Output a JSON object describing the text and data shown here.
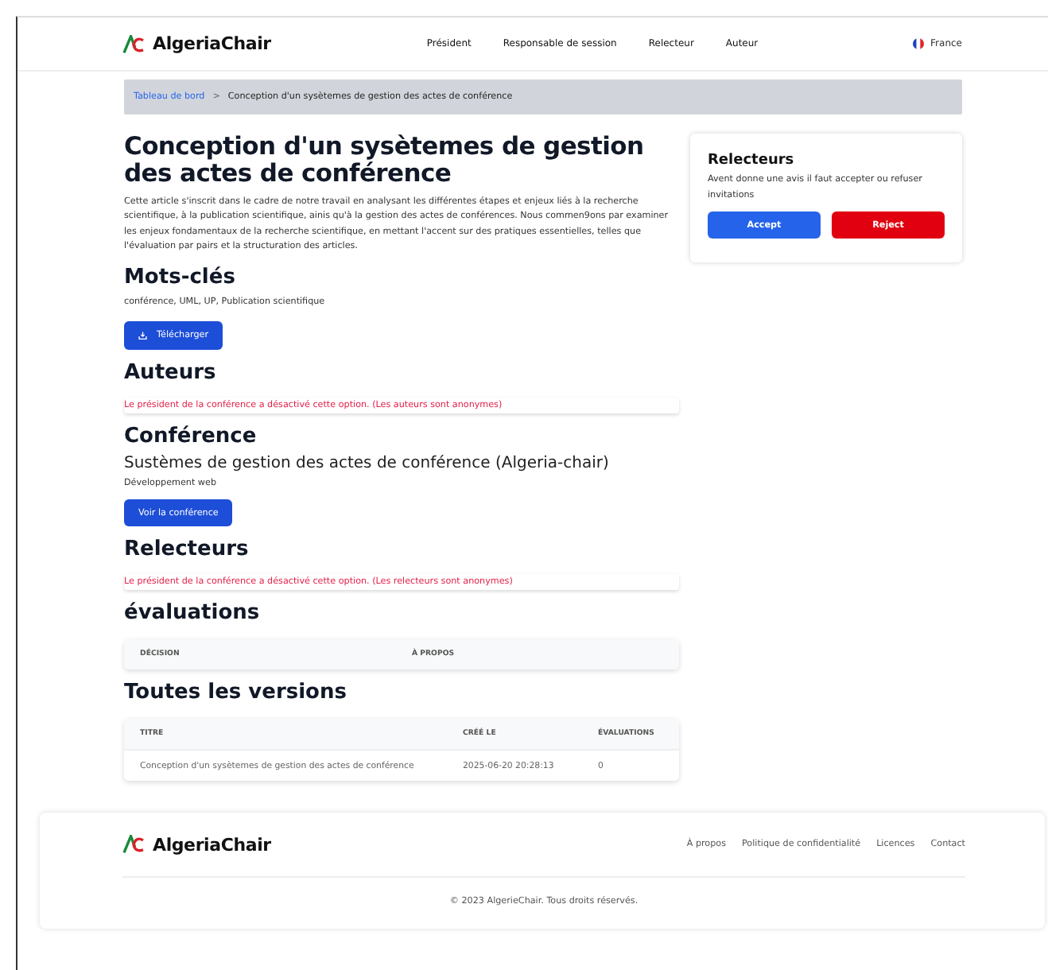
{
  "brand": "AlgeriaChair",
  "nav": [
    "Président",
    "Responsable de session",
    "Relecteur",
    "Auteur"
  ],
  "language": "France",
  "breadcrumb": {
    "link": "Tableau de bord",
    "separator": ">",
    "current": "Conception d'un sysètemes de gestion des actes de conférence"
  },
  "title": "Conception d'un sysètemes de gestion des actes de conférence",
  "abstract": "Cette article s'inscrit dans le cadre de notre travail en analysant les différentes étapes et enjeux liés à la recherche scientifique, à la publication scientifique, ainis qu'à la gestion des actes de conférences. Nous commen9ons par examiner les enjeux fondamentaux de la recherche scientifique, en mettant l'accent sur des pratiques essentielles, telles que l'évaluation par pairs et la structuration des articles.",
  "keywords": {
    "heading": "Mots-clés",
    "text": "conférence, UML, UP, Publication scientifique"
  },
  "download_button": "Télécharger",
  "authors": {
    "heading": "Auteurs",
    "notice": "Le président de la conférence a désactivé cette option. (Les auteurs sont anonymes)"
  },
  "conference": {
    "heading": "Conférence",
    "name": "Sustèmes de gestion des actes de conférence (Algeria-chair)",
    "track": "Développement web",
    "button": "Voir la conférence"
  },
  "reviewers": {
    "heading": "Relecteurs",
    "notice": "Le président de la conférence a désactivé cette option. (Les relecteurs sont anonymes)"
  },
  "evaluations": {
    "heading": "évaluations",
    "columns": [
      "DÉCISION",
      "À PROPOS"
    ]
  },
  "versions": {
    "heading": "Toutes les versions",
    "columns": [
      "TITRE",
      "CRÉÉ LE",
      "ÉVALUATIONS"
    ],
    "rows": [
      [
        "Conception d'un sysètemes de gestion des actes de conférence",
        "2025-06-20 20:28:13",
        "0"
      ]
    ]
  },
  "invite_card": {
    "title": "Relecteurs",
    "text": "Avent donne une avis il faut accepter ou refuser invitations",
    "buttons": [
      {
        "label": "Accept",
        "kind": "accept"
      },
      {
        "label": "Reject",
        "kind": "reject"
      }
    ]
  },
  "footer": {
    "brand": "AlgeriaChair",
    "links": [
      "À propos",
      "Politique de confidentialité",
      "Licences",
      "Contact"
    ],
    "copyright": "© 2023 AlgerieChair. Tous droits réservés."
  }
}
